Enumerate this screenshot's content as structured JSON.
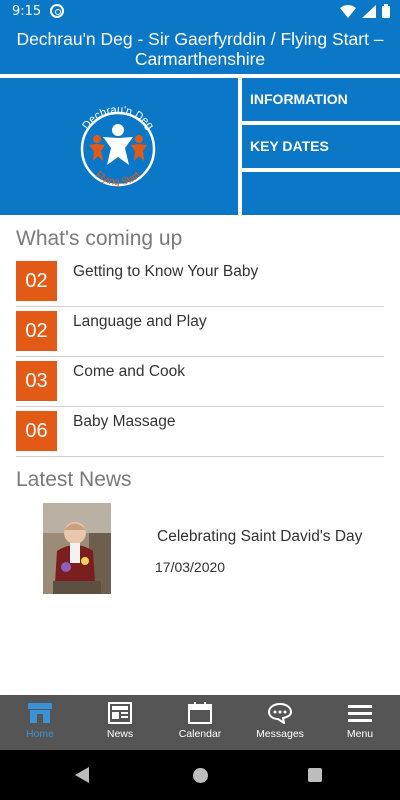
{
  "status_bar": {
    "time": "9:15"
  },
  "header": {
    "title": "Dechrau'n Deg - Sir Gaerfyrddin / Flying Start – Carmarthenshire"
  },
  "logo": {
    "text_top": "Dechrau'n Deg",
    "text_bottom": "Flying Start"
  },
  "tiles": {
    "information": "INFORMATION",
    "key_dates": "KEY DATES"
  },
  "coming_up": {
    "title": "What's coming up",
    "events": [
      {
        "day": "02",
        "title": "Getting to Know Your Baby"
      },
      {
        "day": "02",
        "title": "Language and Play"
      },
      {
        "day": "03",
        "title": "Come and Cook"
      },
      {
        "day": "06",
        "title": "Baby Massage"
      }
    ]
  },
  "news": {
    "title": "Latest News",
    "items": [
      {
        "headline": "Celebrating Saint David's Day",
        "date": "17/03/2020"
      }
    ]
  },
  "bottom_nav": {
    "items": [
      {
        "label": "Home",
        "icon": "home-icon",
        "active": true
      },
      {
        "label": "News",
        "icon": "news-icon"
      },
      {
        "label": "Calendar",
        "icon": "calendar-icon"
      },
      {
        "label": "Messages",
        "icon": "messages-icon"
      },
      {
        "label": "Menu",
        "icon": "menu-icon"
      }
    ]
  },
  "colors": {
    "brand_blue": "#0b78c7",
    "date_orange": "#e35a16",
    "nav_gray": "#555555",
    "active_blue": "#3a93d6"
  }
}
